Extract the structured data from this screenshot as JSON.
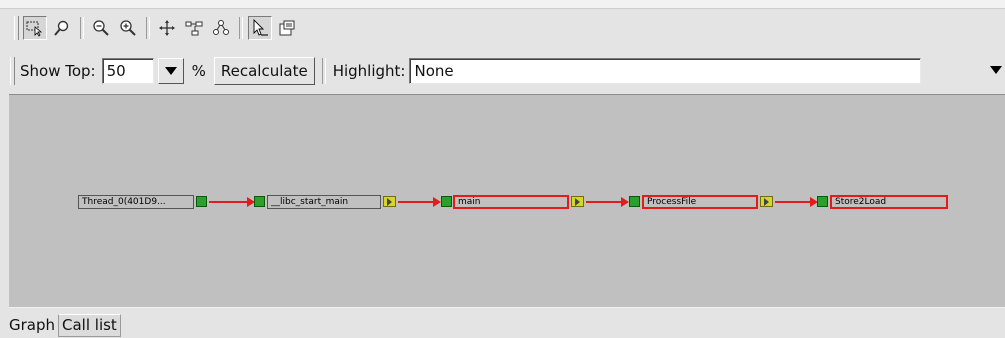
{
  "toolbar": {
    "tools": [
      {
        "icon": "select-region-icon",
        "pressed": true
      },
      {
        "icon": "magnify-lens-icon",
        "pressed": false
      },
      {
        "icon": "zoom-out-icon",
        "pressed": false
      },
      {
        "icon": "zoom-in-icon",
        "pressed": false
      },
      {
        "icon": "pan-move-icon",
        "pressed": false
      },
      {
        "icon": "auto-layout-icon",
        "pressed": false
      },
      {
        "icon": "graph-tree-icon",
        "pressed": false
      },
      {
        "icon": "pointer-select-icon",
        "pressed": true
      },
      {
        "icon": "properties-icon",
        "pressed": false
      }
    ]
  },
  "options": {
    "show_top_label": "Show Top:",
    "show_top_value": "50",
    "percent_label": "%",
    "recalculate_label": "Recalculate",
    "highlight_label": "Highlight:",
    "highlight_value": "None"
  },
  "graph": {
    "nodes": [
      {
        "label": "Thread_0(401D9...",
        "hot": false
      },
      {
        "label": "__libc_start_main",
        "hot": false
      },
      {
        "label": "main",
        "hot": true
      },
      {
        "label": "ProcessFile",
        "hot": true
      },
      {
        "label": "Store2Load",
        "hot": true
      }
    ],
    "colors": {
      "edge": "#e21b1b",
      "hot_border": "#e21b1b",
      "port": "#2ca02c",
      "expander": "#d6d62a",
      "canvas": "#c0c0c0"
    }
  },
  "tabs": [
    {
      "label": "Graph",
      "active": true
    },
    {
      "label": "Call list",
      "active": false
    }
  ]
}
